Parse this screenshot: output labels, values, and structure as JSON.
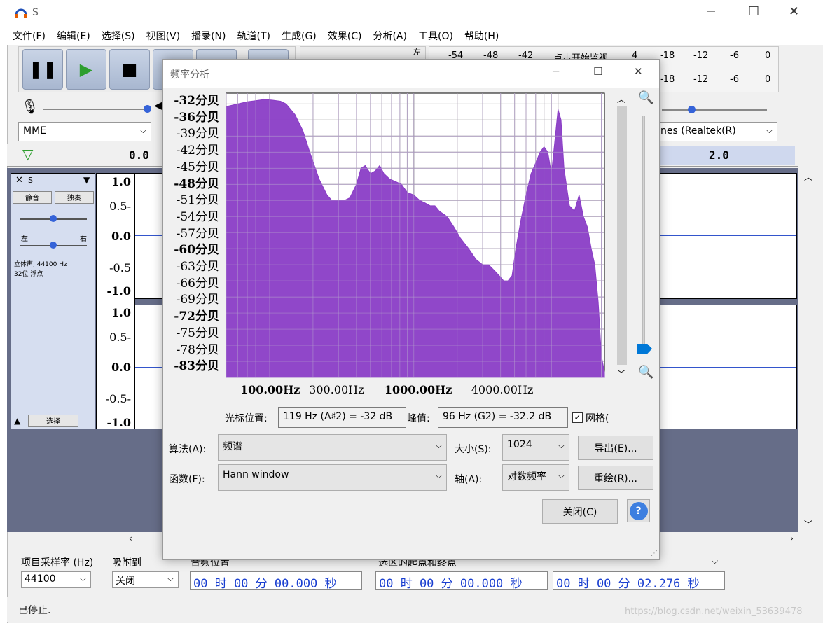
{
  "app": {
    "title": "S",
    "menu": [
      "文件(F)",
      "编辑(E)",
      "选择(S)",
      "视图(V)",
      "播录(N)",
      "轨道(T)",
      "生成(G)",
      "效果(C)",
      "分析(A)",
      "工具(O)",
      "帮助(H)"
    ]
  },
  "toolbar": {
    "host": "MME",
    "output_device": "nes (Realtek(R)",
    "meter_ticks_top": [
      "-54",
      "-48",
      "-42",
      "点击开始监视",
      "4",
      "-18",
      "-12",
      "-6",
      "0"
    ],
    "meter_ticks_bottom": [
      "-18",
      "-12",
      "-6",
      "0"
    ],
    "meter_left_label": "左",
    "timeline_start": "0.0",
    "timeline_right": "2.0"
  },
  "track": {
    "name": "S",
    "mute_label": "静音",
    "solo_label": "独奏",
    "pan_left": "左",
    "pan_right": "右",
    "info_line1": "立体声, 44100 Hz",
    "info_line2": "32位 浮点",
    "select_label": "选择",
    "scale": [
      "1.0",
      "0.5-",
      "0.0",
      "-0.5",
      "-1.0",
      "1.0",
      "0.5-",
      "0.0",
      "-0.5-",
      "-1.0"
    ]
  },
  "bottom": {
    "rate_label": "项目采样率 (Hz)",
    "rate_value": "44100",
    "snap_label": "吸附到",
    "snap_value": "关闭",
    "audio_pos_label": "音频位置",
    "sel_label": "选区的起点和终点",
    "time1": "00 时 00 分 00.000 秒",
    "time2": "00 时 00 分 00.000 秒",
    "time3": "00 时 00 分 02.276 秒",
    "status": "已停止.",
    "watermark": "https://blog.csdn.net/weixin_53639478"
  },
  "dialog": {
    "title": "频率分析",
    "cursor_label": "光标位置:",
    "cursor_value": "119 Hz (A♯2) = -32 dB",
    "peak_label": "峰值:",
    "peak_value": "96 Hz (G2) = -32.2 dB",
    "grid_label": "网格(",
    "algo_label": "算法(A):",
    "algo_value": "频谱",
    "size_label": "大小(S):",
    "size_value": "1024",
    "export_label": "导出(E)...",
    "func_label": "函数(F):",
    "func_value": "Hann window",
    "axis_label": "轴(A):",
    "axis_value": "对数频率",
    "replot_label": "重绘(R)...",
    "close_label": "关闭(C)",
    "help_label": "?"
  },
  "chart_data": {
    "type": "area",
    "title": "",
    "xlabel": "",
    "ylabel": "",
    "xscale": "log",
    "x_tick_labels": [
      "100.00Hz",
      "300.00Hz",
      "1000.00Hz",
      "4000.00Hz"
    ],
    "y_tick_labels": [
      "-32分贝",
      "-36分贝",
      "-39分贝",
      "-42分贝",
      "-45分贝",
      "-48分贝",
      "-51分贝",
      "-54分贝",
      "-57分贝",
      "-60分贝",
      "-63分贝",
      "-66分贝",
      "-69分贝",
      "-72分贝",
      "-75分贝",
      "-78分贝",
      "-83分贝"
    ],
    "ylim": [
      -84,
      -31
    ],
    "xlim": [
      50,
      21000
    ],
    "grid": true,
    "color": "#8a3dc6",
    "series": [
      {
        "x": [
          50,
          60,
          70,
          80,
          90,
          96,
          105,
          119,
          130,
          150,
          170,
          190,
          220,
          250,
          270,
          300,
          330,
          360,
          400,
          430,
          460,
          500,
          540,
          580,
          620,
          680,
          750,
          820,
          900,
          1000,
          1100,
          1200,
          1300,
          1400,
          1500,
          1700,
          1900,
          2100,
          2400,
          2700,
          3000,
          3300,
          3600,
          3900,
          4200,
          4500,
          4800,
          5100,
          5500,
          6000,
          6500,
          7000,
          7500,
          8000,
          8500,
          9000,
          9500,
          10000,
          10500,
          11000,
          12000,
          13000,
          14000,
          15000,
          16000,
          17000,
          18000,
          19000,
          20000,
          21000
        ],
        "y": [
          -33.5,
          -33,
          -32.6,
          -32.4,
          -32.2,
          -32.2,
          -32.3,
          -32.5,
          -33,
          -35,
          -38,
          -42,
          -47,
          -50,
          -51,
          -51,
          -51,
          -50.5,
          -48,
          -45,
          -44.5,
          -46,
          -45.5,
          -44.5,
          -46,
          -47,
          -47.5,
          -48,
          -49.5,
          -50,
          -51,
          -51.5,
          -52,
          -52,
          -53,
          -54,
          -56,
          -58,
          -60,
          -62,
          -63,
          -63,
          -64,
          -65,
          -66,
          -66,
          -65,
          -60,
          -55,
          -50,
          -46,
          -44,
          -42,
          -41,
          -42,
          -46,
          -40,
          -34,
          -36,
          -45,
          -52,
          -53,
          -50,
          -54,
          -56,
          -60,
          -63,
          -70,
          -80,
          -83
        ]
      }
    ]
  }
}
